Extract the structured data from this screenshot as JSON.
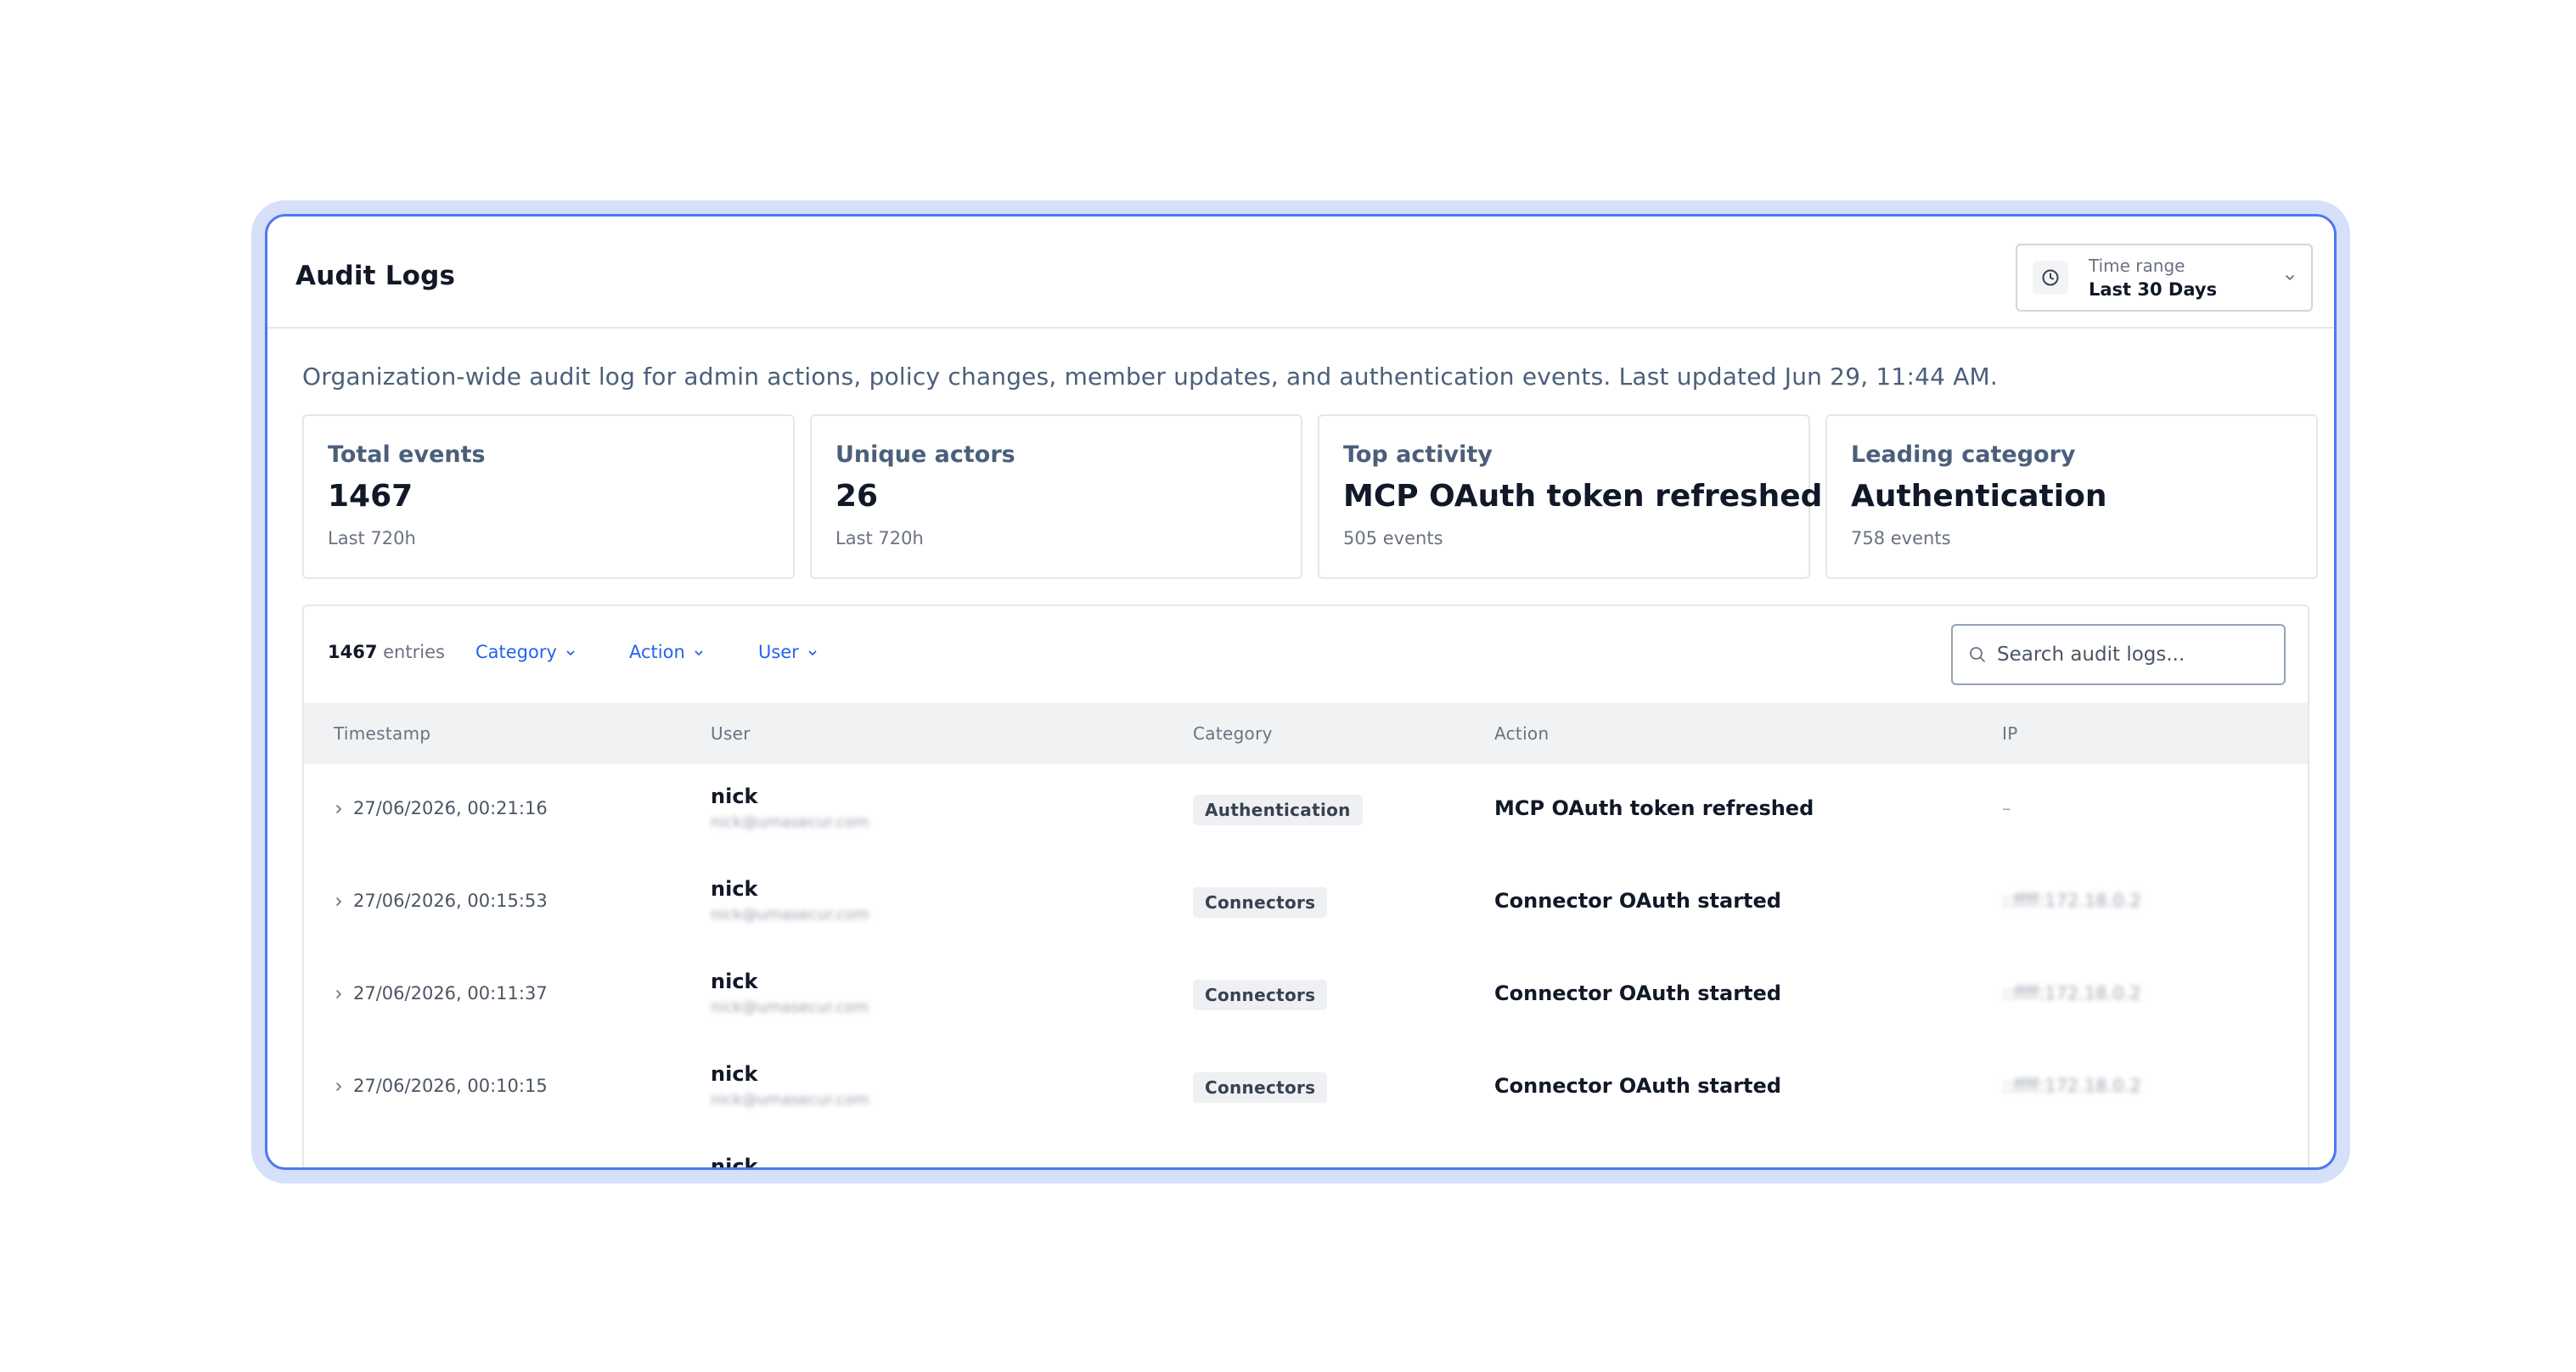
{
  "header": {
    "title": "Audit Logs"
  },
  "time_range": {
    "label": "Time range",
    "value": "Last 30 Days"
  },
  "description": "Organization-wide audit log for admin actions, policy changes, member updates, and authentication events. Last updated Jun 29, 11:44 AM.",
  "stats": [
    {
      "label": "Total events",
      "value": "1467",
      "sub": "Last 720h"
    },
    {
      "label": "Unique actors",
      "value": "26",
      "sub": "Last 720h"
    },
    {
      "label": "Top activity",
      "value": "MCP OAuth token refreshed",
      "sub": "505 events"
    },
    {
      "label": "Leading category",
      "value": "Authentication",
      "sub": "758 events"
    }
  ],
  "toolbar": {
    "entries_count": "1467",
    "entries_label": "entries",
    "filters": [
      "Category",
      "Action",
      "User"
    ],
    "search_placeholder": "Search audit logs..."
  },
  "columns": [
    "Timestamp",
    "User",
    "Category",
    "Action",
    "IP"
  ],
  "rows": [
    {
      "timestamp": "27/06/2026, 00:21:16",
      "user": "nick",
      "email": "nick@umasecur.com",
      "category": "Authentication",
      "action": "MCP OAuth token refreshed",
      "ip": "–"
    },
    {
      "timestamp": "27/06/2026, 00:15:53",
      "user": "nick",
      "email": "nick@umasecur.com",
      "category": "Connectors",
      "action": "Connector OAuth started",
      "ip": "::ffff:172.18.0.2"
    },
    {
      "timestamp": "27/06/2026, 00:11:37",
      "user": "nick",
      "email": "nick@umasecur.com",
      "category": "Connectors",
      "action": "Connector OAuth started",
      "ip": "::ffff:172.18.0.2"
    },
    {
      "timestamp": "27/06/2026, 00:10:15",
      "user": "nick",
      "email": "nick@umasecur.com",
      "category": "Connectors",
      "action": "Connector OAuth started",
      "ip": "::ffff:172.18.0.2"
    },
    {
      "timestamp": "",
      "user": "nick",
      "email": "",
      "category": "",
      "action": "",
      "ip": ""
    }
  ],
  "colors": {
    "accent": "#2563eb",
    "frame": "#4f77f0",
    "halo": "#d6e0fa"
  },
  "icons": {
    "time_range": "clock-icon",
    "dropdown": "chevron-down-icon",
    "search": "search-icon",
    "expand": "chevron-right-icon"
  }
}
